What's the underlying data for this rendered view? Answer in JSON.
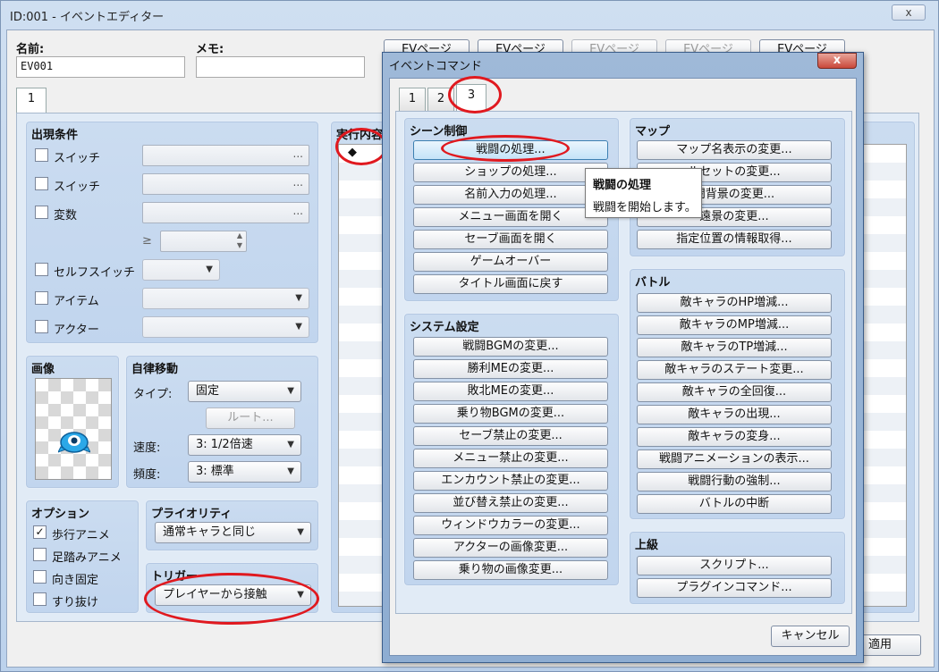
{
  "window": {
    "title": "ID:001 - イベントエディター",
    "close_glyph": "x"
  },
  "event": {
    "name_label": "名前:",
    "name_value": "EV001",
    "memo_label": "メモ:",
    "memo_value": ""
  },
  "page_buttons": [
    "EVページ",
    "EVページ",
    "EVページ",
    "EVページ",
    "EVページ"
  ],
  "page_tab": "1",
  "conditions": {
    "title": "出現条件",
    "items": [
      {
        "label": "スイッチ"
      },
      {
        "label": "スイッチ"
      },
      {
        "label": "変数"
      },
      {
        "label": "セルフスイッチ"
      },
      {
        "label": "アイテム"
      },
      {
        "label": "アクター"
      }
    ],
    "ge_symbol": "≥",
    "ellipsis": "..."
  },
  "image": {
    "title": "画像"
  },
  "autonomous": {
    "title": "自律移動",
    "type_label": "タイプ:",
    "type_value": "固定",
    "route_button": "ルート...",
    "speed_label": "速度:",
    "speed_value": "3: 1/2倍速",
    "freq_label": "頻度:",
    "freq_value": "3: 標準"
  },
  "options": {
    "title": "オプション",
    "items": [
      {
        "label": "歩行アニメ",
        "checked": true
      },
      {
        "label": "足踏みアニメ",
        "checked": false
      },
      {
        "label": "向き固定",
        "checked": false
      },
      {
        "label": "すり抜け",
        "checked": false
      }
    ],
    "check_glyph": "✓"
  },
  "priority": {
    "title": "プライオリティ",
    "value": "通常キャラと同じ"
  },
  "trigger": {
    "title": "トリガー",
    "value": "プレイヤーから接触"
  },
  "contents": {
    "title": "実行内容",
    "first_row": "◆"
  },
  "apply_button": "適用",
  "dialog": {
    "title": "イベントコマンド",
    "close_glyph": "x",
    "tabs": [
      "1",
      "2",
      "3"
    ],
    "scene": {
      "title": "シーン制御",
      "items": [
        "戦闘の処理...",
        "ショップの処理...",
        "名前入力の処理...",
        "メニュー画面を開く",
        "セーブ画面を開く",
        "ゲームオーバー",
        "タイトル画面に戻す"
      ]
    },
    "system": {
      "title": "システム設定",
      "items": [
        "戦闘BGMの変更...",
        "勝利MEの変更...",
        "敗北MEの変更...",
        "乗り物BGMの変更...",
        "セーブ禁止の変更...",
        "メニュー禁止の変更...",
        "エンカウント禁止の変更...",
        "並び替え禁止の変更...",
        "ウィンドウカラーの変更...",
        "アクターの画像変更...",
        "乗り物の画像変更..."
      ]
    },
    "map": {
      "title": "マップ",
      "items": [
        "マップ名表示の変更...",
        "ルセットの変更...",
        "闘背景の変更...",
        "遠景の変更...",
        "指定位置の情報取得..."
      ]
    },
    "battle": {
      "title": "バトル",
      "items": [
        "敵キャラのHP増減...",
        "敵キャラのMP増減...",
        "敵キャラのTP増減...",
        "敵キャラのステート変更...",
        "敵キャラの全回復...",
        "敵キャラの出現...",
        "敵キャラの変身...",
        "戦闘アニメーションの表示...",
        "戦闘行動の強制...",
        "バトルの中断"
      ]
    },
    "advanced": {
      "title": "上級",
      "items": [
        "スクリプト...",
        "プラグインコマンド..."
      ]
    },
    "cancel_button": "キャンセル"
  },
  "tooltip": {
    "title": "戦闘の処理",
    "body": "戦闘を開始します。"
  }
}
